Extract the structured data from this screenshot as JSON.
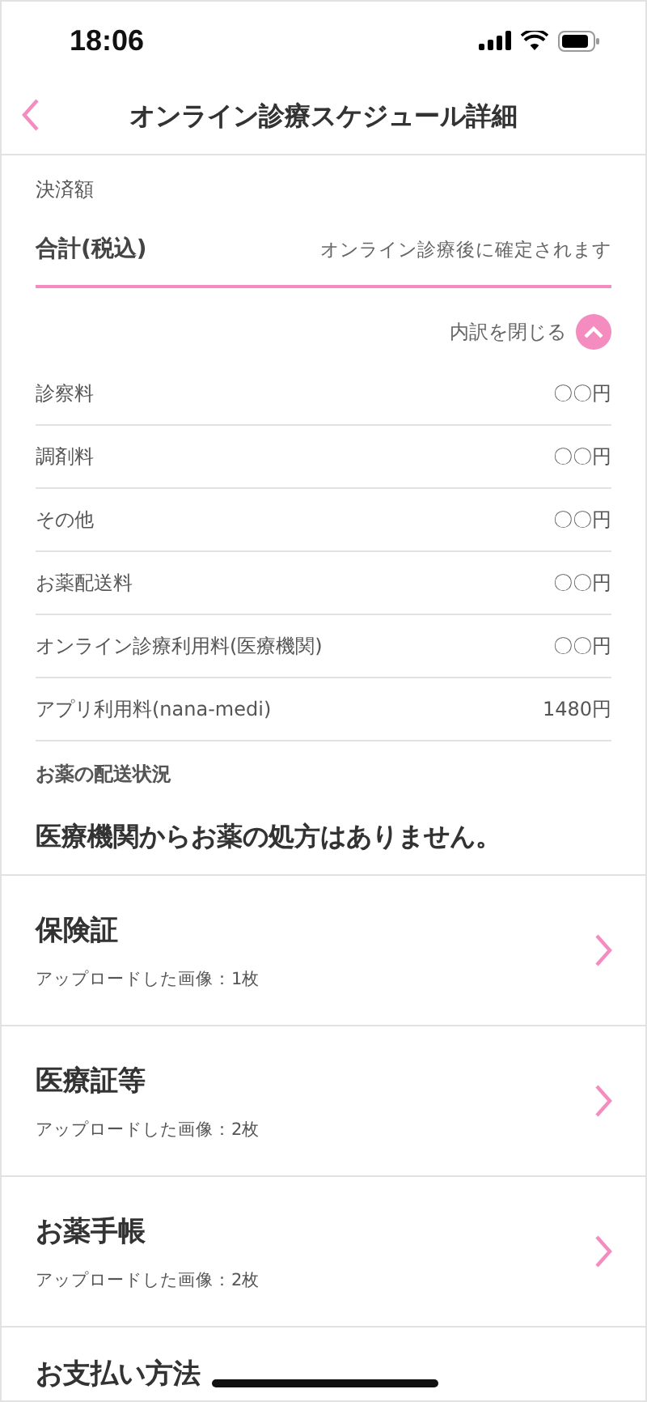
{
  "status_bar": {
    "time": "18:06"
  },
  "header": {
    "title": "オンライン診療スケジュール詳細"
  },
  "payment": {
    "label": "決済額",
    "total_label": "合計(税込)",
    "total_value": "オンライン診療後に確定されます",
    "toggle": {
      "label": "内訳を閉じる",
      "expanded": true
    },
    "items": [
      {
        "name": "診察料",
        "amount": "〇〇円"
      },
      {
        "name": "調剤料",
        "amount": "〇〇円"
      },
      {
        "name": "その他",
        "amount": "〇〇円"
      },
      {
        "name": "お薬配送料",
        "amount": "〇〇円"
      },
      {
        "name": "オンライン診療利用料(医療機関)",
        "amount": "〇〇円"
      },
      {
        "name": "アプリ利用料(nana-medi)",
        "amount": "1480円"
      }
    ]
  },
  "delivery": {
    "label": "お薬の配送状況",
    "message": "医療機関からお薬の処方はありません。"
  },
  "documents": [
    {
      "title": "保険証",
      "subtitle": "アップロードした画像：1枚"
    },
    {
      "title": "医療証等",
      "subtitle": "アップロードした画像：2枚"
    },
    {
      "title": "お薬手帳",
      "subtitle": "アップロードした画像：2枚"
    }
  ],
  "next_section": {
    "title": "お支払い方法"
  }
}
